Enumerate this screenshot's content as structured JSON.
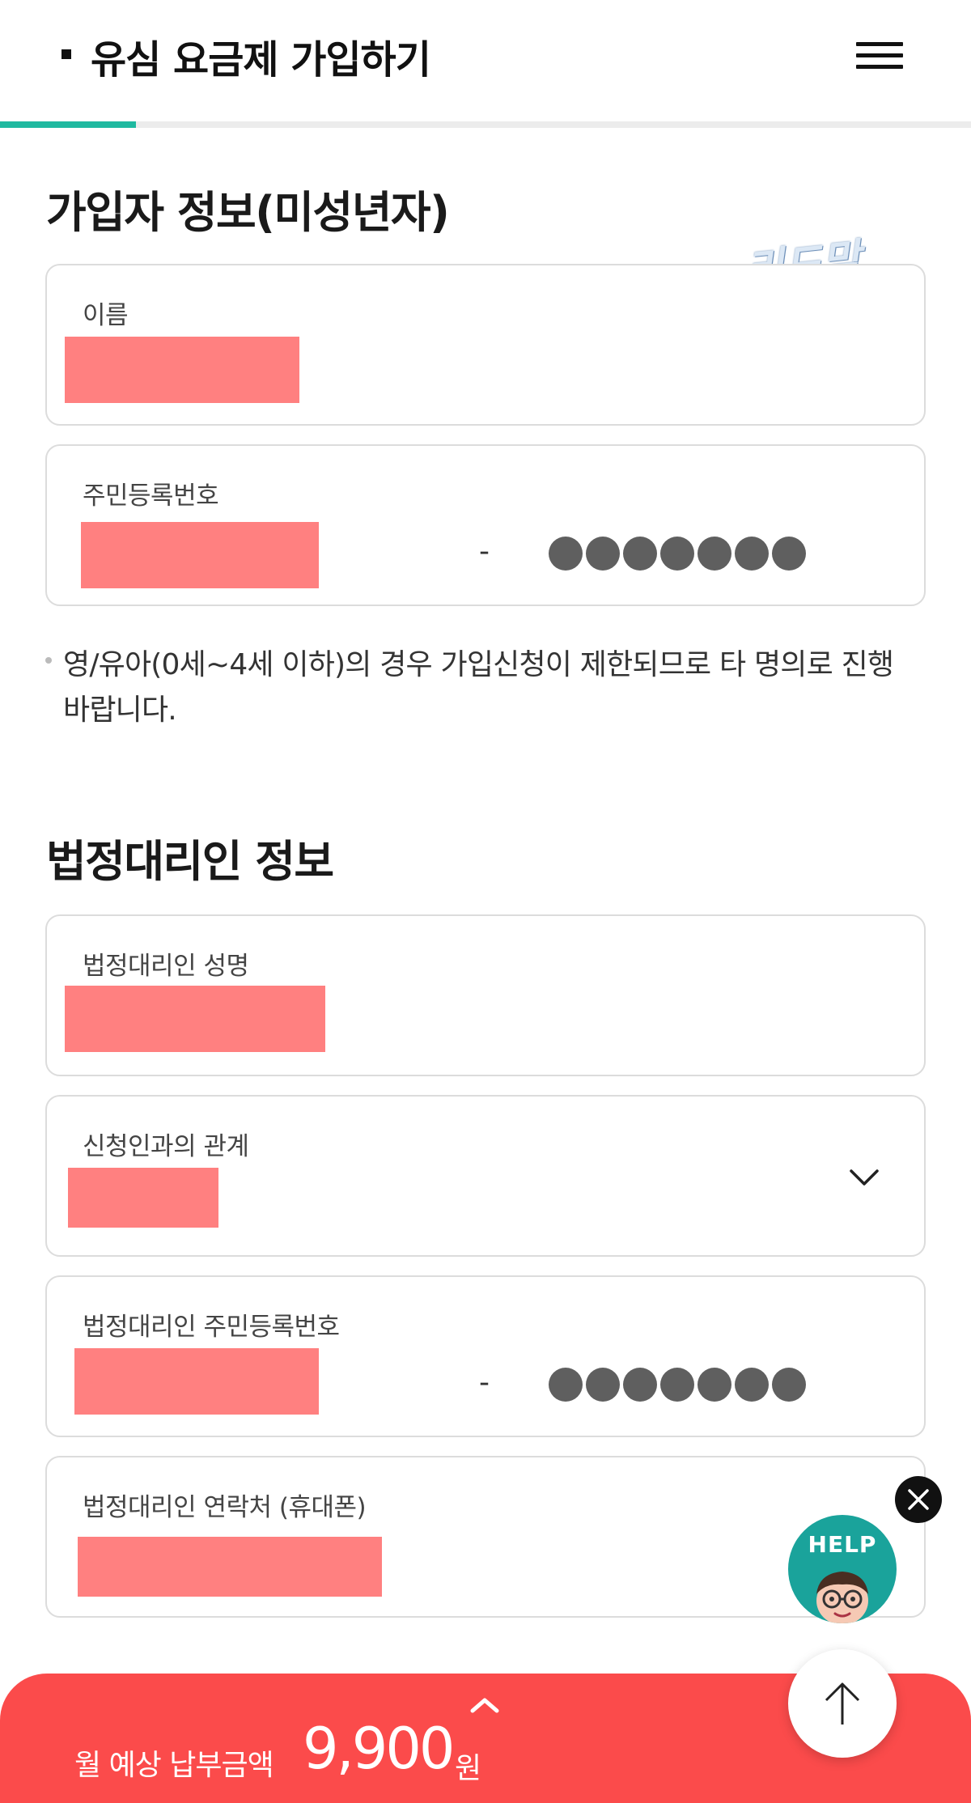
{
  "header": {
    "title": "유심 요금제 가입하기",
    "progress_fraction": 0.14
  },
  "subscriber_section": {
    "title": "가입자 정보(미성년자)",
    "name_label": "이름",
    "rrn_label": "주민등록번호",
    "rrn_separator": "-"
  },
  "notice": "영/유아(0세~4세 이하)의 경우 가입신청이 제한되므로 타 명의로 진행 바랍니다.",
  "guardian_section": {
    "title": "법정대리인 정보",
    "name_label": "법정대리인 성명",
    "relation_label": "신청인과의 관계",
    "rrn_label": "법정대리인 주민등록번호",
    "rrn_separator": "-",
    "phone_label": "법정대리인 연락처 (휴대폰)"
  },
  "watermark": "리드맘",
  "help": {
    "label": "HELP"
  },
  "bottom_bar": {
    "label": "월 예상 납부금액",
    "amount": "9,900",
    "unit": "원"
  },
  "colors": {
    "accent_teal": "#1fb9a0",
    "redaction": "#ff8080",
    "bottom_bar": "#fb4b4b",
    "help_teal": "#1aa39b"
  },
  "icons": [
    "menu-icon",
    "chevron-down-icon",
    "close-icon",
    "help-mascot-icon",
    "arrow-up-icon",
    "chevron-up-icon"
  ]
}
